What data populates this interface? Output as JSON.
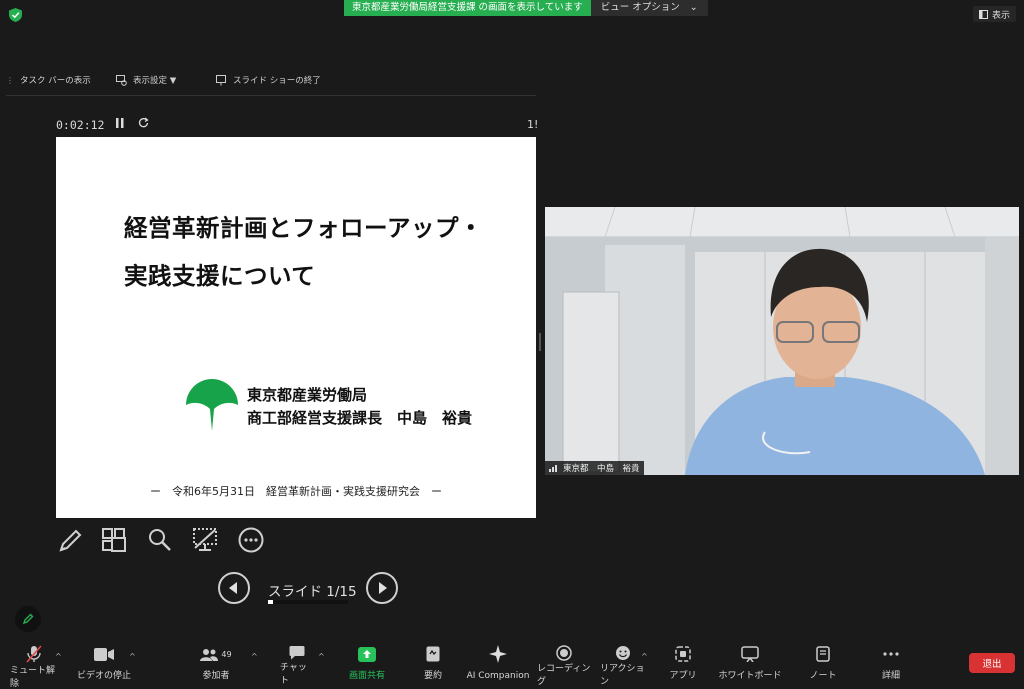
{
  "top": {
    "share_banner": "東京都産業労働局経営支援課 の画面を表示しています",
    "view_options": "ビュー オプション",
    "view_caret": "⌄",
    "show_button": "表示",
    "colors": {
      "banner": "#27ae50",
      "leave": "#d93232"
    }
  },
  "presenter_toolbar": {
    "taskbar": "タスク バーの表示",
    "display_settings": "表示設定 ▼",
    "end_slideshow": "スライド ショーの終了"
  },
  "slideshow": {
    "timer": "0:02:12",
    "slide_number_cut": "1!",
    "title_line1": "経営革新計画とフォローアップ・",
    "title_line2": "実践支援について",
    "org_name": "東京都産業労働局",
    "org_role": "商工部経営支援課長　中島　裕貴",
    "footer": "ー　令和6年5月31日　経営革新計画・実践支援研究会　ー",
    "counter": "スライド 1/15",
    "progress": 0.0667
  },
  "video": {
    "label": "東京都　中島　裕貴"
  },
  "bottom_bar": {
    "mute": "ミュート解除",
    "video": "ビデオの停止",
    "participants": "参加者",
    "participants_count": "49",
    "chat": "チャット",
    "share": "画面共有",
    "summary": "要約",
    "ai": "AI Companion",
    "record": "レコーディング",
    "reactions": "リアクション",
    "apps": "アプリ",
    "whiteboard": "ホワイトボード",
    "notes": "ノート",
    "more": "詳細",
    "leave": "退出"
  }
}
